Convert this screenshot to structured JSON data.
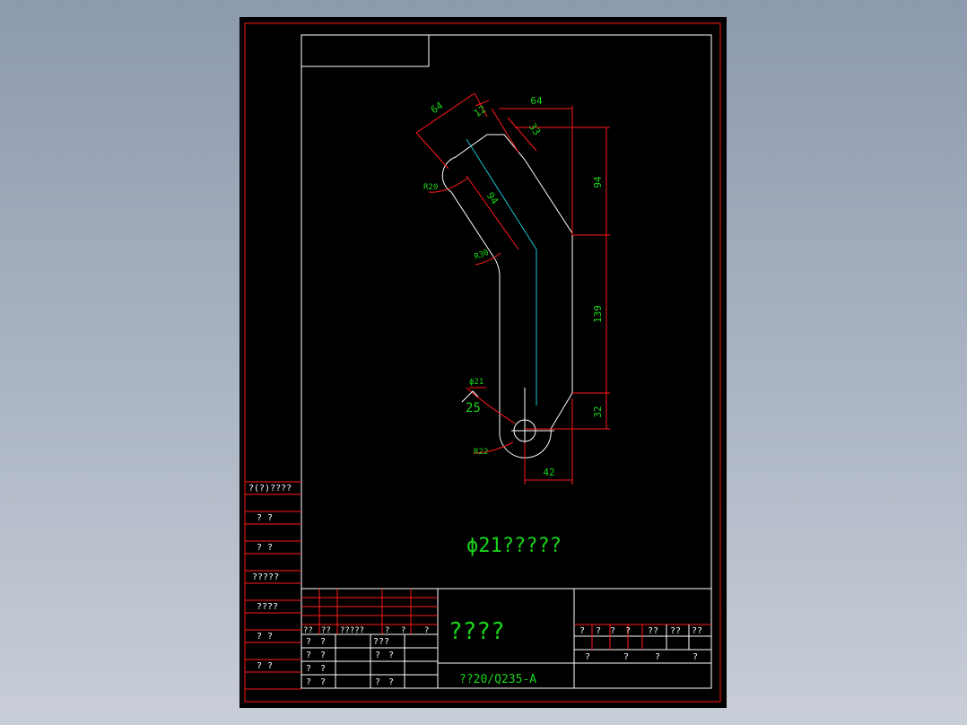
{
  "drawing": {
    "colors": {
      "background": "#000000",
      "border": "#ff1a1a",
      "geometry": "#ffffff",
      "centerline": "#17c4d8",
      "dimension_text": "#19d419",
      "table_text": "#ffffff"
    },
    "dimensions": {
      "d64_angled": "64",
      "d12": "12",
      "d33": "33",
      "d64_top": "64",
      "d94_right": "94",
      "d94_angled": "94",
      "d139": "139",
      "d32": "32",
      "d42": "42",
      "r20": "R20",
      "r30": "R30",
      "r22": "R22",
      "phi21": "ϕ21",
      "roughness": "25"
    },
    "note": "ϕ21?????"
  },
  "side_column": {
    "labels": [
      "?(?)????",
      "?  ?",
      "?  ?",
      "?????",
      "????",
      "?  ?",
      "?  ?"
    ]
  },
  "title_block": {
    "title": "????",
    "material": "??20/Q235-A",
    "signoff_header": [
      "??",
      "??",
      "?????",
      "?",
      "?",
      "?"
    ],
    "signoff_rows": [
      [
        "?",
        "?",
        "???"
      ],
      [
        "?",
        "?",
        "?",
        "?"
      ],
      [
        "?",
        "?"
      ],
      [
        "?",
        "?",
        "?",
        "?"
      ]
    ],
    "right_header": [
      "?",
      "?",
      "?",
      "?",
      "??",
      "??",
      "??"
    ],
    "right_row": [
      "?",
      "?",
      "?",
      "?"
    ]
  }
}
